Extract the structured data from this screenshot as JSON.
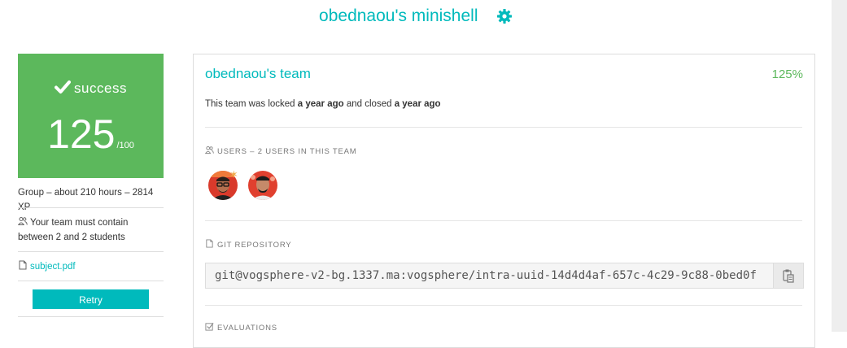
{
  "header": {
    "title": "obednaou's minishell",
    "settings_icon": "gear-icon"
  },
  "colors": {
    "accent": "#00babc",
    "success": "#5cb85c"
  },
  "grade": {
    "status": "success",
    "score": "125",
    "max": "/100",
    "status_icon": "check-icon"
  },
  "sidebar": {
    "project_info": "Group – about 210 hours – 2814 XP",
    "team_rule": "Your team must contain between 2 and 2 students",
    "team_rule_icon": "users-icon",
    "subject_link": "subject.pdf",
    "subject_icon": "file-icon",
    "retry_label": "Retry"
  },
  "team": {
    "name": "obednaou's team",
    "percentage": "125%",
    "lock_prefix": "This team was locked ",
    "locked_when": "a year ago",
    "lock_middle": " and closed ",
    "closed_when": "a year ago",
    "users_label": "USERS – 2 USERS IN THIS TEAM",
    "users": [
      {
        "avatar": "avatar-1",
        "leader": true
      },
      {
        "avatar": "avatar-2",
        "leader": false
      }
    ],
    "git_label": "GIT REPOSITORY",
    "git_url": "git@vogsphere-v2-bg.1337.ma:vogsphere/intra-uuid-14d4d4af-657c-4c29-9c88-0bed0f",
    "copy_icon": "clipboard-icon",
    "evaluations_label": "EVALUATIONS"
  }
}
